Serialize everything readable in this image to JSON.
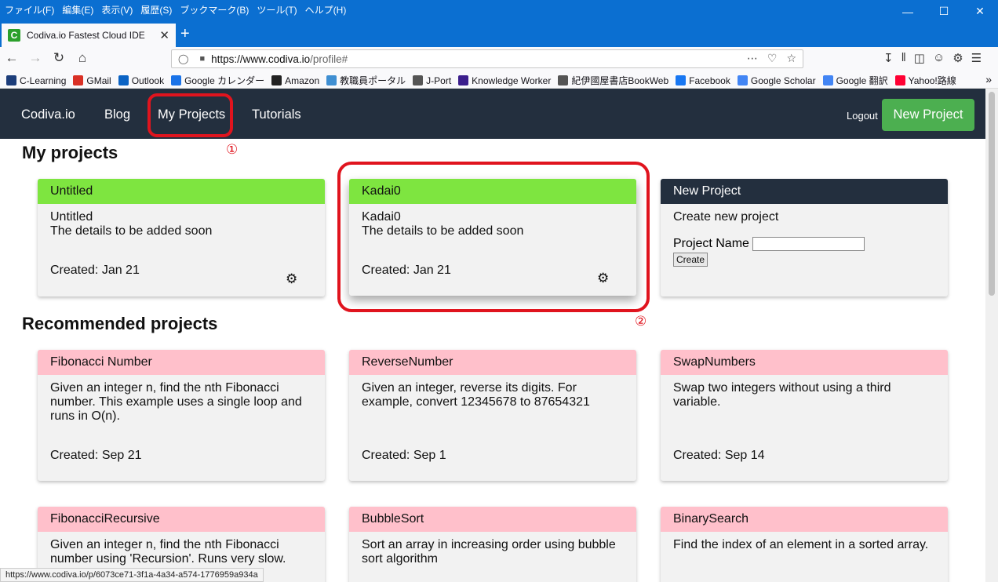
{
  "browser": {
    "menu": [
      "ファイル(F)",
      "編集(E)",
      "表示(V)",
      "履歴(S)",
      "ブックマーク(B)",
      "ツール(T)",
      "ヘルプ(H)"
    ],
    "tab_title": "Codiva.io Fastest Cloud IDE",
    "tab_favicon": "C",
    "url_host": "https://www.codiva.io",
    "url_path": "/profile#",
    "bookmarks": [
      {
        "label": "C-Learning",
        "icon": "c-learning-icon",
        "color": "#1c3d7a"
      },
      {
        "label": "GMail",
        "icon": "gmail-icon",
        "color": "#d93025"
      },
      {
        "label": "Outlook",
        "icon": "outlook-icon",
        "color": "#0b63c4"
      },
      {
        "label": "Google カレンダー",
        "icon": "calendar-icon",
        "color": "#1a73e8"
      },
      {
        "label": "Amazon",
        "icon": "amazon-icon",
        "color": "#222222"
      },
      {
        "label": "教職員ポータル",
        "icon": "portal-icon",
        "color": "#3f8fd2"
      },
      {
        "label": "J-Port",
        "icon": "globe-icon",
        "color": "#555555"
      },
      {
        "label": "Knowledge Worker",
        "icon": "knowledge-worker-icon",
        "color": "#3b1e8c"
      },
      {
        "label": "紀伊國屋書店BookWeb",
        "icon": "globe-icon",
        "color": "#555555"
      },
      {
        "label": "Facebook",
        "icon": "facebook-icon",
        "color": "#1877f2"
      },
      {
        "label": "Google Scholar",
        "icon": "scholar-icon",
        "color": "#4285f4"
      },
      {
        "label": "Google 翻訳",
        "icon": "translate-icon",
        "color": "#4285f4"
      },
      {
        "label": "Yahoo!路線",
        "icon": "yahoo-icon",
        "color": "#ff0033"
      }
    ],
    "status_url": "https://www.codiva.io/p/6073ce71-3f1a-4a34-a574-1776959a934a"
  },
  "site": {
    "brand": "Codiva.io",
    "nav": {
      "blog": "Blog",
      "my_projects": "My Projects",
      "tutorials": "Tutorials"
    },
    "logout": "Logout",
    "new_project_button": "New Project",
    "annotations": {
      "one": "①",
      "two": "②"
    },
    "my_projects_heading": "My projects",
    "recommended_heading": "Recommended projects",
    "my_projects": [
      {
        "title": "Untitled",
        "name": "Untitled",
        "details": "The details to be added soon",
        "created": "Created: Jan 21"
      },
      {
        "title": "Kadai0",
        "name": "Kadai0",
        "details": "The details to be added soon",
        "created": "Created: Jan 21"
      }
    ],
    "new_project_card": {
      "title": "New Project",
      "subtitle": "Create new project",
      "field_label": "Project Name",
      "field_value": "",
      "create_button": "Create"
    },
    "recommended": [
      {
        "title": "Fibonacci Number",
        "desc": "Given an integer n, find the nth Fibonacci number. This example uses a single loop and runs in O(n).",
        "created": "Created: Sep 21"
      },
      {
        "title": "ReverseNumber",
        "desc": "Given an integer, reverse its digits. For example, convert 12345678 to 87654321",
        "created": "Created: Sep 1"
      },
      {
        "title": "SwapNumbers",
        "desc": "Swap two integers without using a third variable.",
        "created": "Created: Sep 14"
      },
      {
        "title": "FibonacciRecursive",
        "desc": "Given an integer n, find the nth Fibonacci number using 'Recursion'. Runs very slow.",
        "created": ""
      },
      {
        "title": "BubbleSort",
        "desc": "Sort an array in increasing order using bubble sort algorithm",
        "created": ""
      },
      {
        "title": "BinarySearch",
        "desc": "Find the index of an element in a sorted array.",
        "created": ""
      }
    ],
    "colors": {
      "nav_bg": "#232f3e",
      "green_header": "#7ee540",
      "pink_header": "#ffc0cb",
      "button_green": "#4caf50",
      "highlight_red": "#e0141e"
    }
  }
}
